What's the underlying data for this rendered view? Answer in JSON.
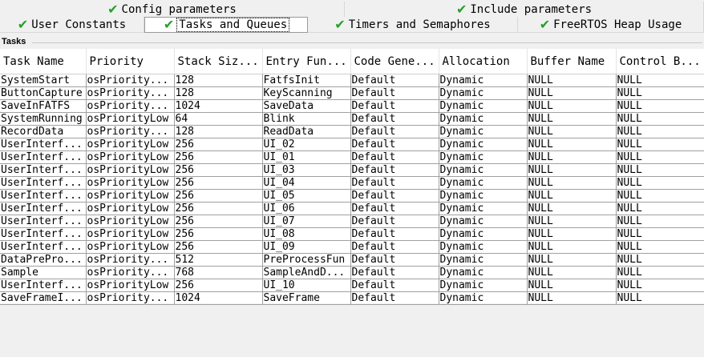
{
  "tabs_row1": [
    {
      "label": "Config parameters",
      "checked": true
    },
    {
      "label": "Include parameters",
      "checked": true
    }
  ],
  "tabs_row2": [
    {
      "label": "User Constants",
      "checked": true
    },
    {
      "label": "Tasks and Queues",
      "checked": true,
      "selected": true
    },
    {
      "label": "Timers and Semaphores",
      "checked": true
    },
    {
      "label": "FreeRTOS Heap Usage",
      "checked": true
    }
  ],
  "section_title": "Tasks",
  "columns": [
    "Task Name",
    "Priority",
    "Stack Siz...",
    "Entry Fun...",
    "Code Gene...",
    "Allocation",
    "Buffer Name",
    "Control B..."
  ],
  "rows": [
    [
      "SystemStart",
      "osPriority...",
      "128",
      "FatfsInit",
      "Default",
      "Dynamic",
      "NULL",
      "NULL"
    ],
    [
      "ButtonCapture",
      "osPriority...",
      "128",
      "KeyScanning",
      "Default",
      "Dynamic",
      "NULL",
      "NULL"
    ],
    [
      "SaveInFATFS",
      "osPriority...",
      "1024",
      "SaveData",
      "Default",
      "Dynamic",
      "NULL",
      "NULL"
    ],
    [
      "SystemRunning",
      "osPriorityLow",
      "64",
      "Blink",
      "Default",
      "Dynamic",
      "NULL",
      "NULL"
    ],
    [
      "RecordData",
      "osPriority...",
      "128",
      "ReadData",
      "Default",
      "Dynamic",
      "NULL",
      "NULL"
    ],
    [
      "UserInterf...",
      "osPriorityLow",
      "256",
      "UI_02",
      "Default",
      "Dynamic",
      "NULL",
      "NULL"
    ],
    [
      "UserInterf...",
      "osPriorityLow",
      "256",
      "UI_01",
      "Default",
      "Dynamic",
      "NULL",
      "NULL"
    ],
    [
      "UserInterf...",
      "osPriorityLow",
      "256",
      "UI_03",
      "Default",
      "Dynamic",
      "NULL",
      "NULL"
    ],
    [
      "UserInterf...",
      "osPriorityLow",
      "256",
      "UI_04",
      "Default",
      "Dynamic",
      "NULL",
      "NULL"
    ],
    [
      "UserInterf...",
      "osPriorityLow",
      "256",
      "UI_05",
      "Default",
      "Dynamic",
      "NULL",
      "NULL"
    ],
    [
      "UserInterf...",
      "osPriorityLow",
      "256",
      "UI_06",
      "Default",
      "Dynamic",
      "NULL",
      "NULL"
    ],
    [
      "UserInterf...",
      "osPriorityLow",
      "256",
      "UI_07",
      "Default",
      "Dynamic",
      "NULL",
      "NULL"
    ],
    [
      "UserInterf...",
      "osPriorityLow",
      "256",
      "UI_08",
      "Default",
      "Dynamic",
      "NULL",
      "NULL"
    ],
    [
      "UserInterf...",
      "osPriorityLow",
      "256",
      "UI_09",
      "Default",
      "Dynamic",
      "NULL",
      "NULL"
    ],
    [
      "DataPrePro...",
      "osPriority...",
      "512",
      "PreProcessFun",
      "Default",
      "Dynamic",
      "NULL",
      "NULL"
    ],
    [
      "Sample",
      "osPriority...",
      "768",
      "SampleAndD...",
      "Default",
      "Dynamic",
      "NULL",
      "NULL"
    ],
    [
      "UserInterf...",
      "osPriorityLow",
      "256",
      "UI_10",
      "Default",
      "Dynamic",
      "NULL",
      "NULL"
    ],
    [
      "SaveFrameI...",
      "osPriority...",
      "1024",
      "SaveFrame",
      "Default",
      "Dynamic",
      "NULL",
      "NULL"
    ]
  ],
  "colors": {
    "check": "#25a028",
    "grid": "#a0a0a0",
    "background": "#f0f0f0"
  },
  "icons": {
    "check": "check-icon"
  }
}
